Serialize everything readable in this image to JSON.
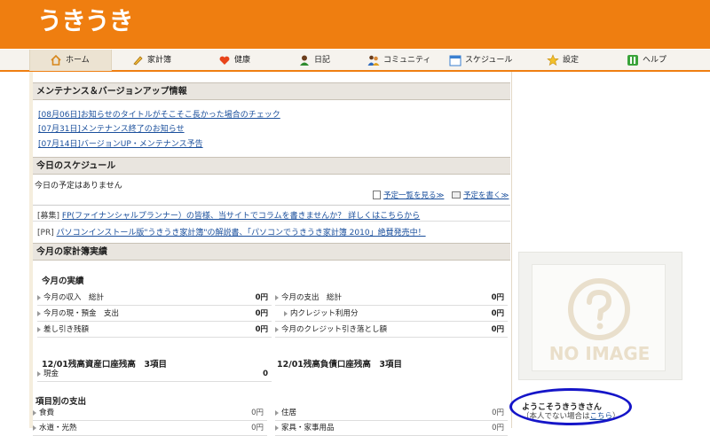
{
  "logo": "うきうき",
  "nav": [
    {
      "label": "ホーム",
      "icon": "home-icon"
    },
    {
      "label": "家計簿",
      "icon": "pencil-icon"
    },
    {
      "label": "健康",
      "icon": "heart-icon"
    },
    {
      "label": "日記",
      "icon": "person-icon"
    },
    {
      "label": "コミュニティ",
      "icon": "community-icon"
    },
    {
      "label": "スケジュール",
      "icon": "calendar-icon"
    },
    {
      "label": "設定",
      "icon": "star-icon"
    },
    {
      "label": "ヘルプ",
      "icon": "help-icon"
    }
  ],
  "maintenance": {
    "title": "メンテナンス＆バージョンアップ情報",
    "items": [
      "[08月06日]お知らせのタイトルがそこそこ長かった場合のチェック",
      "[07月31日]メンテナンス終了のお知らせ",
      "[07月14日]バージョンUP・メンテナンス予告"
    ]
  },
  "schedule": {
    "title": "今日のスケジュール",
    "empty": "今日の予定はありません",
    "list_link": "予定一覧を見る≫",
    "write_link": "予定を書く≫"
  },
  "ads": [
    {
      "tag": "[募集]",
      "text": "FP(ファイナンシャルプランナー）の皆様、当サイトでコラムを書きませんか？ 詳しくはこちらから"
    },
    {
      "tag": "[PR]",
      "text": "パソコンインストール版\"うきうき家計簿\"の解説書、「パソコンでうきうき家計簿 2010」絶賛発売中！"
    }
  ],
  "kakeibo": {
    "title": "今月の家計簿実績",
    "sub": "今月の実績",
    "left_rows": [
      {
        "label": "今月の収入　総計",
        "value": "0円"
      },
      {
        "label": "今月の現・預金　支出",
        "value": "0円"
      },
      {
        "label": "差し引き残額",
        "value": "0円"
      }
    ],
    "right_rows": [
      {
        "label": "今月の支出　総計",
        "value": "0円"
      },
      {
        "label": "内クレジット利用分",
        "value": "0円"
      },
      {
        "label": "今月のクレジット引き落とし額",
        "value": "0円"
      }
    ],
    "asset_title": "12/01残高資産口座残高　3項目",
    "debt_title": "12/01残高負債口座残高　3項目",
    "asset_rows": [
      {
        "label": "現金",
        "value": "0"
      }
    ],
    "expense_title": "項目別の支出",
    "expense_left": [
      {
        "label": "食費",
        "value": "0円"
      },
      {
        "label": "水道・光熱",
        "value": "0円"
      }
    ],
    "expense_right": [
      {
        "label": "住居",
        "value": "0円"
      },
      {
        "label": "家具・家事用品",
        "value": "0円"
      }
    ]
  },
  "profile": {
    "noimage": "NO IMAGE",
    "welcome": "ようこそうきうきさん",
    "not_you_prefix": "（本人でない場合は",
    "not_you_link": "こちら",
    "not_you_suffix": "）"
  },
  "colors": {
    "header": "#ef7e10",
    "annotation_circle": "#1515c8"
  }
}
